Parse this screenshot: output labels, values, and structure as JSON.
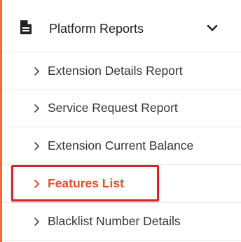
{
  "menu": {
    "header": {
      "title": "Platform Reports",
      "icon": "document-icon",
      "toggle_icon": "chevron-down-icon"
    },
    "items": [
      {
        "label": "Extension Details Report",
        "active": false
      },
      {
        "label": "Service Request Report",
        "active": false
      },
      {
        "label": "Extension Current Balance",
        "active": false
      },
      {
        "label": "Features List",
        "active": true
      },
      {
        "label": "Blacklist Number Details",
        "active": false
      }
    ]
  },
  "colors": {
    "accent": "#f26b3a",
    "active_text": "#e8502c",
    "highlight_border": "#d8232a",
    "text": "#333333"
  }
}
